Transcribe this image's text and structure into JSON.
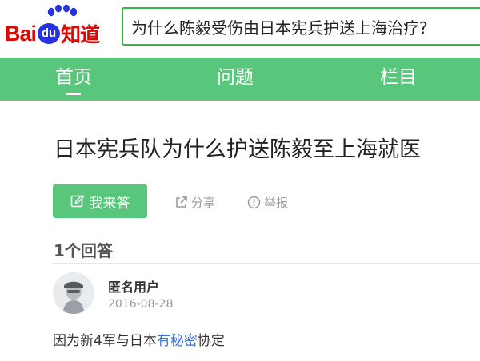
{
  "header": {
    "logo": {
      "bai": "Bai",
      "du": "du",
      "zhidao": "知道"
    },
    "search": {
      "value": "为什么陈毅受伤由日本宪兵护送上海治疗?"
    }
  },
  "nav": {
    "tabs": [
      {
        "label": "首页",
        "active": true
      },
      {
        "label": "问题",
        "active": false
      },
      {
        "label": "栏目",
        "active": false
      }
    ]
  },
  "question": {
    "title": "日本宪兵队为什么护送陈毅至上海就医",
    "answer_button": "我来答",
    "share": "分享",
    "report": "举报"
  },
  "answers": {
    "count_label": "1个回答",
    "items": [
      {
        "user": "匿名用户",
        "date": "2016-08-28",
        "text_before": "因为新4军与日本",
        "text_link": "有秘密",
        "text_after": "协定"
      }
    ]
  },
  "colors": {
    "brand_green": "#58c77b",
    "baidu_red": "#e10602",
    "baidu_blue": "#2932e1",
    "link_blue": "#3a6ec9"
  },
  "icons": {
    "logo_paw": "paw-icon",
    "answer": "edit-icon",
    "share": "share-icon",
    "report": "alert-icon",
    "avatar": "anonymous-user-icon"
  }
}
